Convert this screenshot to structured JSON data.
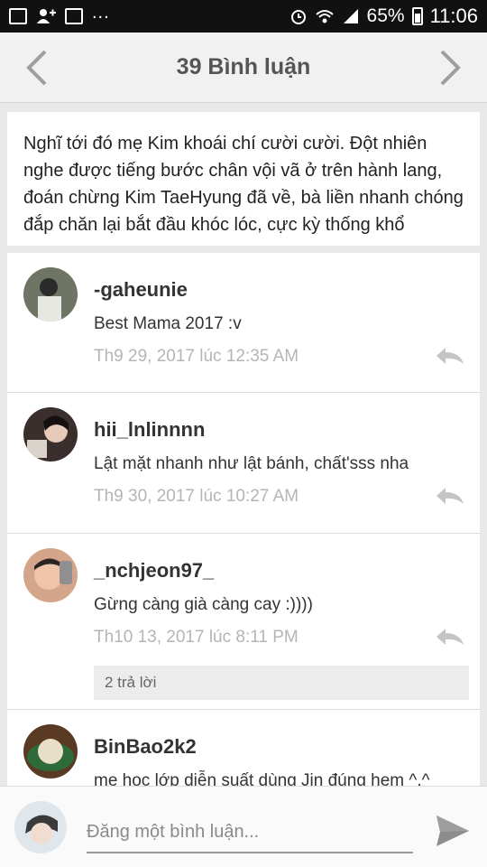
{
  "status_bar": {
    "battery": "65%",
    "time": "11:06",
    "overflow": "..."
  },
  "header": {
    "title": "39 Bình luận",
    "prev_icon": "chevron-left-icon",
    "next_icon": "chevron-right-icon"
  },
  "excerpt": {
    "text": "Nghĩ tới đó mẹ Kim khoái chí cười cười. Đột nhiên nghe được tiếng bước chân vội vã ở trên hành lang, đoán chừng Kim TaeHyung đã về, bà liền nhanh chóng đắp chăn lại bắt đầu khóc lóc, cực kỳ thống khổ"
  },
  "comments": [
    {
      "user": "-gaheunie",
      "text": "Best Mama 2017 :v",
      "time": "Th9 29, 2017 lúc 12:35 AM"
    },
    {
      "user": "hii_lnlinnnn",
      "text": "Lật mặt nhanh như lật bánh, chất'sss nha",
      "time": "Th9 30, 2017 lúc 10:27 AM"
    },
    {
      "user": "_nchjeon97_",
      "text": "Gừng càng già càng cay :))))",
      "time": "Th10 13, 2017 lúc 8:11 PM",
      "replies": "2 trả lời"
    },
    {
      "user": "BinBao2k2",
      "text": "mẹ học lớp diễn suất dùng Jin đúng hem ^.^",
      "time": ""
    }
  ],
  "composer": {
    "placeholder": "Đăng một bình luận..."
  },
  "colors": {
    "status_bar": "#111111",
    "header_bg": "#f1f1f1",
    "page_bg": "#e9e9e9",
    "timestamp": "#b5b5b5",
    "icon_gray": "#9e9e9e"
  }
}
